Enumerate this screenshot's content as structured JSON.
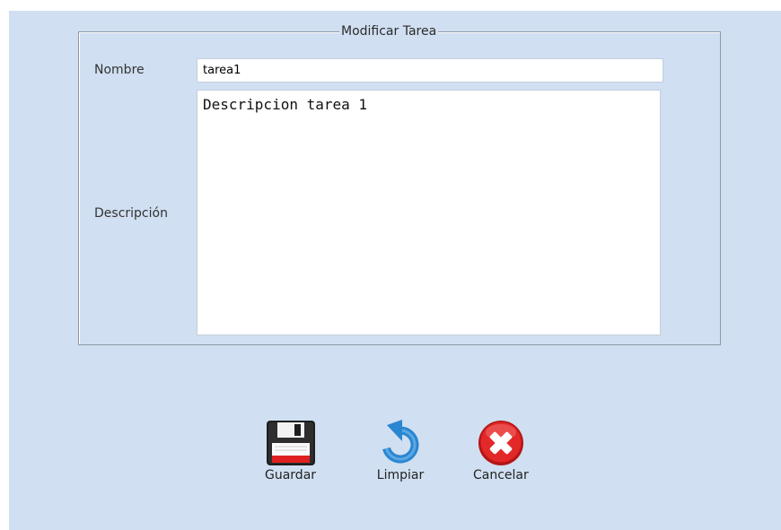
{
  "form": {
    "legend": "Modificar Tarea",
    "name_label": "Nombre",
    "name_value": "tarea1",
    "description_label": "Descripción",
    "description_value": "Descripcion tarea 1"
  },
  "actions": {
    "save_label": "Guardar",
    "save_icon": "floppy-disk-icon",
    "reset_label": "Limpiar",
    "reset_icon": "undo-arrow-icon",
    "cancel_label": "Cancelar",
    "cancel_icon": "red-x-cancel-icon"
  },
  "colors": {
    "background": "#d0dff1",
    "cancel_red": "#d82020",
    "reset_blue": "#2a86d1"
  }
}
